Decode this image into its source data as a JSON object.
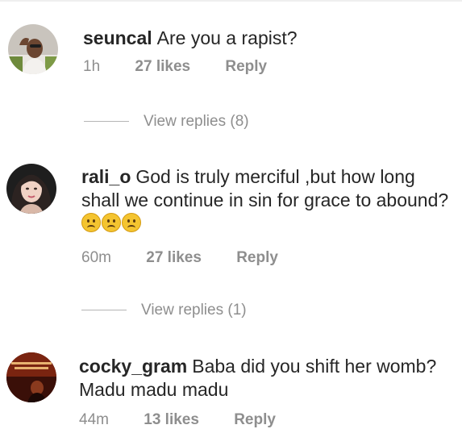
{
  "comments": [
    {
      "username": "seuncal",
      "text": "Are you a rapist?",
      "time": "1h",
      "likes": "27 likes",
      "reply": "Reply",
      "view_replies": "View replies (8)"
    },
    {
      "username": "rali_o",
      "text": "God is truly merciful ,but how long shall we continue in sin for grace to abound?",
      "emojis": [
        "frowning-face",
        "frowning-face",
        "frowning-face"
      ],
      "time": "60m",
      "likes": "27 likes",
      "reply": "Reply",
      "view_replies": "View replies (1)"
    },
    {
      "username": "cocky_gram",
      "text": "Baba did you shift her womb? Madu madu madu",
      "time": "44m",
      "likes": "13 likes",
      "reply": "Reply"
    }
  ],
  "colors": {
    "text": "#262626",
    "meta": "#8e8e8e",
    "emoji": "#f4c430"
  }
}
